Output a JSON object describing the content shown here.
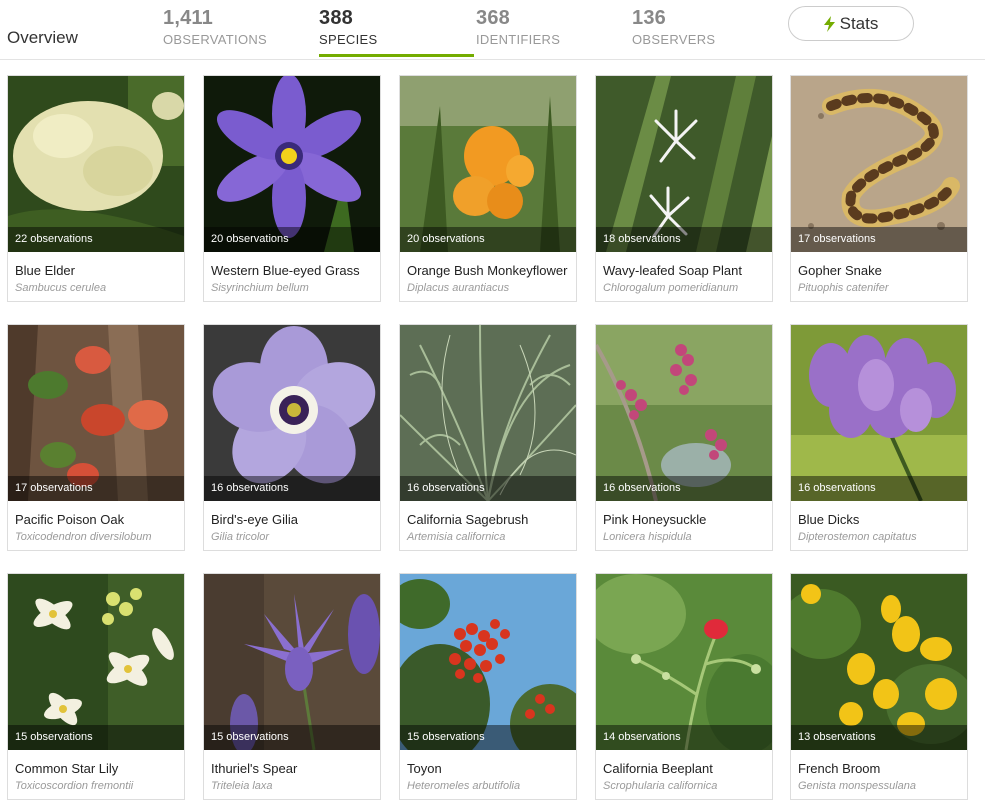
{
  "header": {
    "overview_label": "Overview",
    "stats": [
      {
        "value": "1,411",
        "label": "OBSERVATIONS"
      },
      {
        "value": "388",
        "label": "SPECIES"
      },
      {
        "value": "368",
        "label": "IDENTIFIERS"
      },
      {
        "value": "136",
        "label": "OBSERVERS"
      }
    ],
    "stats_button_label": "Stats",
    "accent_color": "#74ac00"
  },
  "species": [
    {
      "observations": "22 observations",
      "common_name": "Blue Elder",
      "scientific_name": "Sambucus cerulea"
    },
    {
      "observations": "20 observations",
      "common_name": "Western Blue-eyed Grass",
      "scientific_name": "Sisyrinchium bellum"
    },
    {
      "observations": "20 observations",
      "common_name": "Orange Bush Monkeyflower",
      "scientific_name": "Diplacus aurantiacus"
    },
    {
      "observations": "18 observations",
      "common_name": "Wavy-leafed Soap Plant",
      "scientific_name": "Chlorogalum pomeridianum"
    },
    {
      "observations": "17 observations",
      "common_name": "Gopher Snake",
      "scientific_name": "Pituophis catenifer"
    },
    {
      "observations": "17 observations",
      "common_name": "Pacific Poison Oak",
      "scientific_name": "Toxicodendron diversilobum"
    },
    {
      "observations": "16 observations",
      "common_name": "Bird's-eye Gilia",
      "scientific_name": "Gilia tricolor"
    },
    {
      "observations": "16 observations",
      "common_name": "California Sagebrush",
      "scientific_name": "Artemisia californica"
    },
    {
      "observations": "16 observations",
      "common_name": "Pink Honeysuckle",
      "scientific_name": "Lonicera hispidula"
    },
    {
      "observations": "16 observations",
      "common_name": "Blue Dicks",
      "scientific_name": "Dipterostemon capitatus"
    },
    {
      "observations": "15 observations",
      "common_name": "Common Star Lily",
      "scientific_name": "Toxicoscordion fremontii"
    },
    {
      "observations": "15 observations",
      "common_name": "Ithuriel's Spear",
      "scientific_name": "Triteleia laxa"
    },
    {
      "observations": "15 observations",
      "common_name": "Toyon",
      "scientific_name": "Heteromeles arbutifolia"
    },
    {
      "observations": "14 observations",
      "common_name": "California Beeplant",
      "scientific_name": "Scrophularia californica"
    },
    {
      "observations": "13 observations",
      "common_name": "French Broom",
      "scientific_name": "Genista monspessulana"
    }
  ]
}
